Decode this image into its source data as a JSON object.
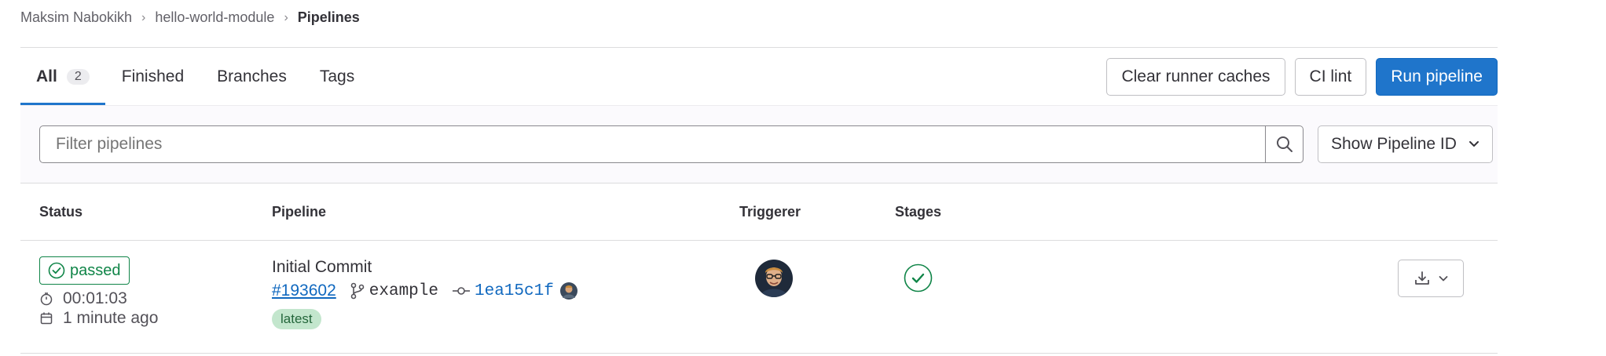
{
  "breadcrumb": {
    "items": [
      "Maksim Nabokikh",
      "hello-world-module",
      "Pipelines"
    ],
    "separator": "›"
  },
  "tabs": [
    {
      "label": "All",
      "count": "2",
      "active": true
    },
    {
      "label": "Finished"
    },
    {
      "label": "Branches"
    },
    {
      "label": "Tags"
    }
  ],
  "actions": {
    "clear_caches": "Clear runner caches",
    "ci_lint": "CI lint",
    "run_pipeline": "Run pipeline"
  },
  "filter": {
    "placeholder": "Filter pipelines",
    "select_label": "Show Pipeline ID"
  },
  "table": {
    "headers": {
      "status": "Status",
      "pipeline": "Pipeline",
      "triggerer": "Triggerer",
      "stages": "Stages"
    },
    "rows": [
      {
        "status": "passed",
        "duration": "00:01:03",
        "finished": "1 minute ago",
        "commit_title": "Initial Commit",
        "pipeline_id": "#193602",
        "ref": "example",
        "sha": "1ea15c1f",
        "badge": "latest"
      }
    ]
  },
  "colors": {
    "primary": "#1f75cb",
    "success": "#108548",
    "link": "#1068bf"
  },
  "icons": [
    "chevron-right-icon",
    "search-icon",
    "chevron-down-icon",
    "status-success-icon",
    "clock-icon",
    "calendar-icon",
    "branch-icon",
    "commit-icon",
    "download-icon"
  ]
}
